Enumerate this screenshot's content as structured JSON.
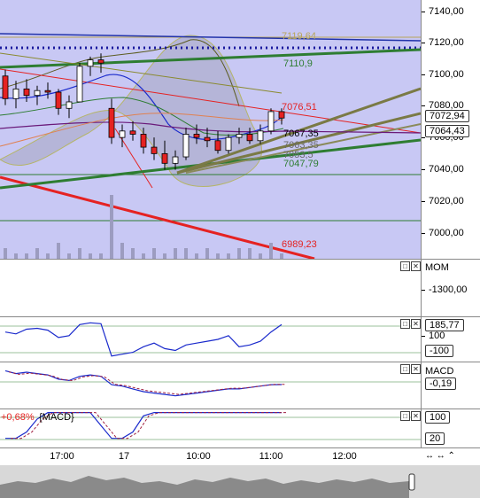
{
  "price_axis": {
    "ticks": [
      "7140,00",
      "7120,00",
      "7100,00",
      "7080,00",
      "7060,00",
      "7040,00",
      "7020,00",
      "7000,00"
    ],
    "last_price": "7072,94",
    "second_price": "7064,43"
  },
  "levels": {
    "upper_band": "7119,64",
    "mid_line": "7110,9",
    "resistance": "7076,51",
    "ma1": "7067,35",
    "ma2": "7063,35",
    "ma3": "7053,5",
    "support": "7047,79",
    "channel_low": "6989,23"
  },
  "panes": {
    "mom": {
      "label": "MOM",
      "tick": "-1300,00"
    },
    "osc": {
      "value": "185,77",
      "tick_high": "100",
      "tick_low": "-100"
    },
    "macd": {
      "label": "MACD",
      "value": "-0,19"
    },
    "stoch": {
      "legend_pct": "+0,68%",
      "legend_name": "{MACD}",
      "tick_high": "100",
      "tick_low": "20"
    }
  },
  "time_axis": {
    "labels": [
      "17:00",
      "17",
      "10:00",
      "11:00",
      "12:00"
    ]
  },
  "controls": {
    "restore": "□",
    "close": "✕",
    "nav_icons": "↔ ↔ ⌃"
  },
  "colors": {
    "plot_bg": "#c8c8f4",
    "support": "#2e7d32",
    "resistance": "#e52222",
    "dotted": "#1a1a9e"
  },
  "chart_data": {
    "type": "candlestick",
    "title": "",
    "ylim": [
      6985,
      7145
    ],
    "x_labels": [
      "17:00",
      "17",
      "10:00",
      "11:00",
      "12:00"
    ],
    "candles": [
      {
        "o": 7098,
        "h": 7102,
        "l": 7080,
        "c": 7084
      },
      {
        "o": 7084,
        "h": 7095,
        "l": 7078,
        "c": 7090
      },
      {
        "o": 7090,
        "h": 7096,
        "l": 7082,
        "c": 7086
      },
      {
        "o": 7086,
        "h": 7092,
        "l": 7080,
        "c": 7089
      },
      {
        "o": 7089,
        "h": 7094,
        "l": 7084,
        "c": 7088
      },
      {
        "o": 7088,
        "h": 7090,
        "l": 7074,
        "c": 7078
      },
      {
        "o": 7078,
        "h": 7086,
        "l": 7072,
        "c": 7082
      },
      {
        "o": 7082,
        "h": 7106,
        "l": 7082,
        "c": 7104
      },
      {
        "o": 7104,
        "h": 7110,
        "l": 7098,
        "c": 7108
      },
      {
        "o": 7108,
        "h": 7112,
        "l": 7100,
        "c": 7106
      },
      {
        "o": 7078,
        "h": 7084,
        "l": 7056,
        "c": 7060
      },
      {
        "o": 7060,
        "h": 7068,
        "l": 7054,
        "c": 7064
      },
      {
        "o": 7064,
        "h": 7070,
        "l": 7058,
        "c": 7062
      },
      {
        "o": 7062,
        "h": 7066,
        "l": 7050,
        "c": 7054
      },
      {
        "o": 7054,
        "h": 7060,
        "l": 7046,
        "c": 7050
      },
      {
        "o": 7050,
        "h": 7058,
        "l": 7040,
        "c": 7044
      },
      {
        "o": 7044,
        "h": 7052,
        "l": 7040,
        "c": 7048
      },
      {
        "o": 7048,
        "h": 7066,
        "l": 7046,
        "c": 7062
      },
      {
        "o": 7062,
        "h": 7068,
        "l": 7056,
        "c": 7060
      },
      {
        "o": 7060,
        "h": 7066,
        "l": 7054,
        "c": 7058
      },
      {
        "o": 7058,
        "h": 7064,
        "l": 7050,
        "c": 7052
      },
      {
        "o": 7052,
        "h": 7062,
        "l": 7050,
        "c": 7060
      },
      {
        "o": 7060,
        "h": 7066,
        "l": 7056,
        "c": 7062
      },
      {
        "o": 7062,
        "h": 7066,
        "l": 7056,
        "c": 7058
      },
      {
        "o": 7058,
        "h": 7068,
        "l": 7056,
        "c": 7064
      },
      {
        "o": 7064,
        "h": 7078,
        "l": 7062,
        "c": 7076
      },
      {
        "o": 7076,
        "h": 7078,
        "l": 7068,
        "c": 7072
      }
    ],
    "volume": [
      2,
      1,
      1,
      2,
      1,
      3,
      1,
      2,
      1,
      1,
      12,
      3,
      2,
      1,
      2,
      1,
      2,
      2,
      1,
      2,
      1,
      1,
      2,
      2,
      1,
      3,
      1
    ],
    "osc_values": [
      40,
      30,
      55,
      60,
      50,
      10,
      20,
      80,
      90,
      85,
      -90,
      -80,
      -70,
      -40,
      -20,
      -50,
      -60,
      -30,
      -20,
      -10,
      0,
      20,
      -40,
      -30,
      -10,
      40,
      80
    ],
    "macd_values": [
      0.8,
      0.6,
      0.7,
      0.6,
      0.5,
      0.2,
      0.1,
      0.4,
      0.5,
      0.4,
      -0.2,
      -0.3,
      -0.5,
      -0.7,
      -0.8,
      -0.9,
      -1.0,
      -0.9,
      -0.8,
      -0.7,
      -0.6,
      -0.5,
      -0.5,
      -0.4,
      -0.3,
      -0.2,
      -0.19
    ],
    "stoch_values": [
      20,
      20,
      40,
      80,
      100,
      100,
      100,
      100,
      100,
      60,
      20,
      20,
      40,
      90,
      100,
      100,
      100,
      100,
      100,
      100,
      100,
      100,
      100,
      100,
      100,
      100,
      100
    ]
  }
}
